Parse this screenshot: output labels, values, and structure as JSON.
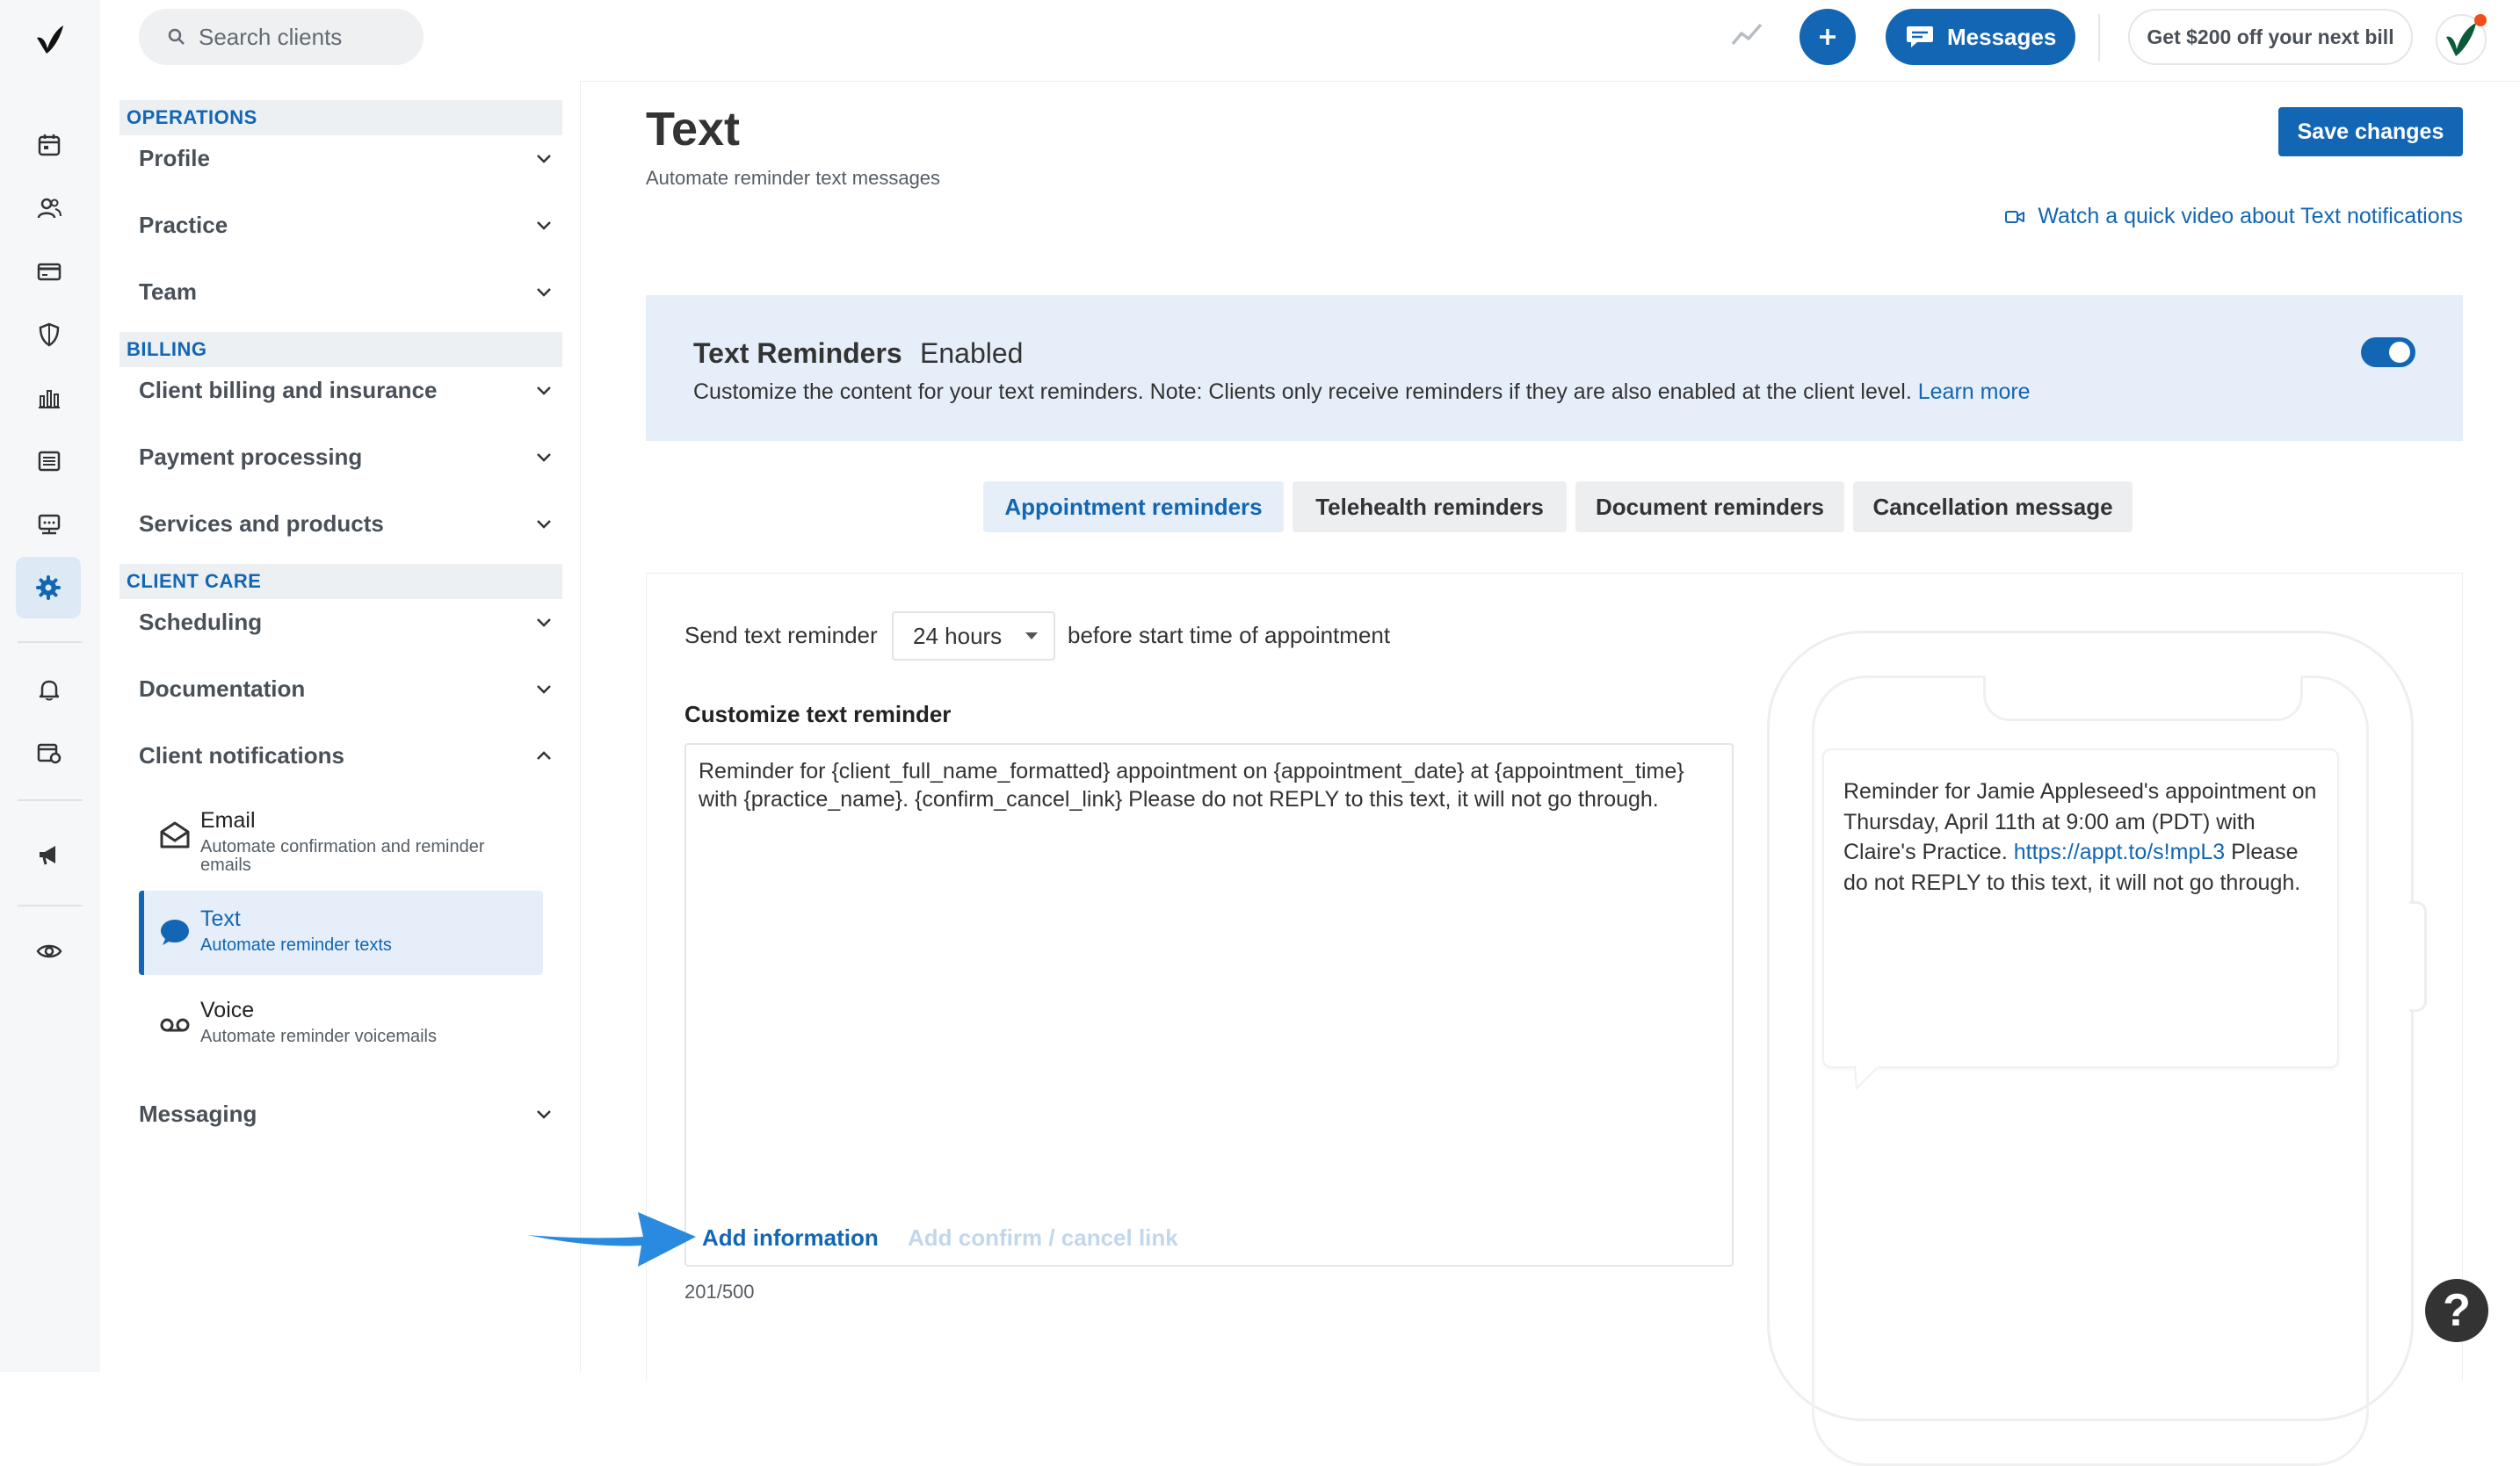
{
  "topbar": {
    "search_placeholder": "Search clients",
    "messages_label": "Messages",
    "promo_label": "Get $200 off your next bill"
  },
  "settings_nav": {
    "sections": [
      {
        "title": "OPERATIONS",
        "items": [
          "Profile",
          "Practice",
          "Team"
        ]
      },
      {
        "title": "BILLING",
        "items": [
          "Client billing and insurance",
          "Payment processing",
          "Services and products"
        ]
      },
      {
        "title": "CLIENT CARE",
        "items": [
          "Scheduling",
          "Documentation",
          "Client notifications"
        ]
      }
    ],
    "notifications_sub": [
      {
        "title": "Email",
        "desc": "Automate confirmation and reminder emails",
        "icon": "envelope-icon"
      },
      {
        "title": "Text",
        "desc": "Automate reminder texts",
        "icon": "chat-bubble-icon"
      },
      {
        "title": "Voice",
        "desc": "Automate reminder voicemails",
        "icon": "voicemail-icon"
      }
    ],
    "messaging_label": "Messaging"
  },
  "page": {
    "title": "Text",
    "subtitle": "Automate reminder text messages",
    "save_label": "Save changes",
    "video_link": "Watch a quick video about Text notifications"
  },
  "banner": {
    "title": "Text Reminders",
    "status": "Enabled",
    "description": "Customize the content for your text reminders. Note: Clients only receive reminders if they are also enabled at the client level.",
    "learn_more": "Learn more",
    "enabled": true
  },
  "tabs": [
    "Appointment reminders",
    "Telehealth reminders",
    "Document reminders",
    "Cancellation message"
  ],
  "active_tab": 0,
  "reminder": {
    "send_label": "Send text reminder",
    "hours_value": "24 hours",
    "after_label": "before start time of appointment",
    "custom_label": "Customize text reminder",
    "template_text": "Reminder for {client_full_name_formatted} appointment on {appointment_date} at {appointment_time} with {practice_name}. {confirm_cancel_link} Please do not REPLY to this text, it will not go through.",
    "add_information": "Add information",
    "add_confirm_cancel": "Add confirm / cancel link",
    "char_count": "201/500"
  },
  "preview": {
    "text_before_link": "Reminder for Jamie Appleseed's appointment on Thursday, April 11th at 9:00 am (PDT) with Claire's Practice.",
    "link": "https://appt.to/s!mpL3",
    "text_after_link": "Please do not REPLY to this text, it will not go through."
  },
  "help_label": "?",
  "colors": {
    "accent": "#1266b3",
    "banner_bg": "#e6eff9",
    "arrow": "#2a8ae0"
  }
}
